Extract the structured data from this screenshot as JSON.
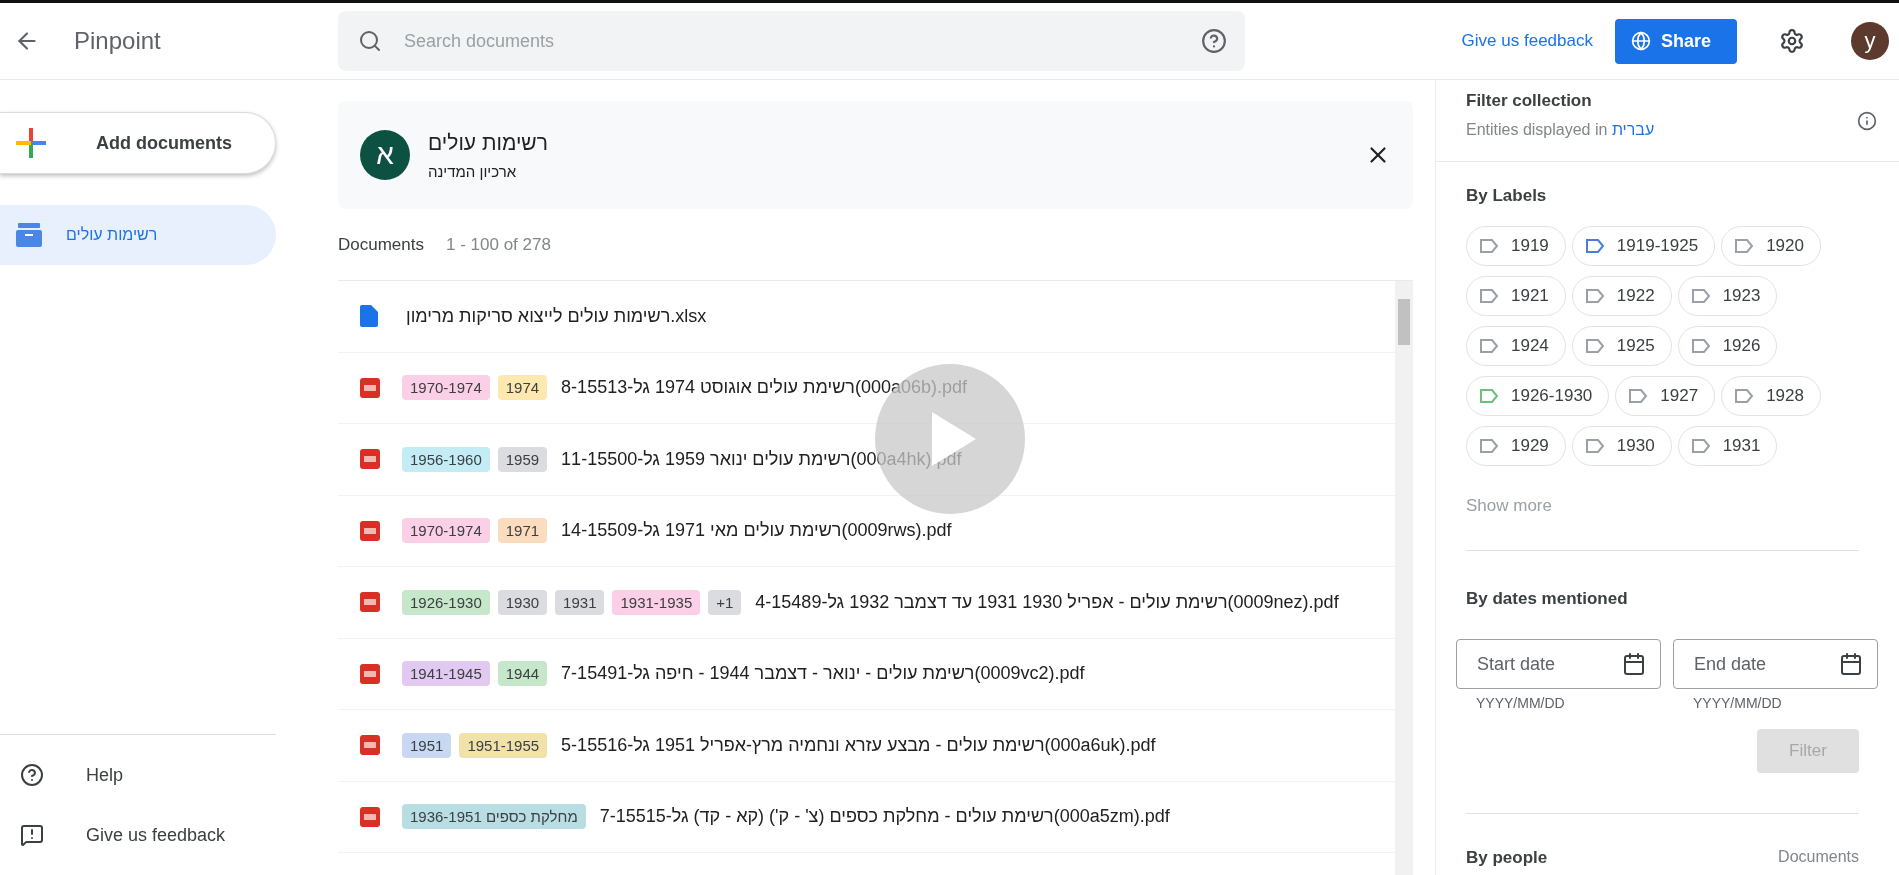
{
  "header": {
    "title": "Pinpoint",
    "search": {
      "placeholder": "Search documents"
    },
    "feedback_link": "Give us feedback",
    "share_button": "Share",
    "avatar": "y"
  },
  "sidebar": {
    "add_button": "Add documents",
    "collections": [
      {
        "label": "רשימות עולים",
        "selected": true
      }
    ],
    "footer": [
      {
        "kind": "help",
        "label": "Help"
      },
      {
        "kind": "feedback",
        "label": "Give us feedback"
      }
    ]
  },
  "collection": {
    "avatar": "א",
    "title": "רשימות עולים",
    "subtitle": "ארכיון המדינה"
  },
  "documents": {
    "title": "Documents",
    "range": "1 - 100 of 278",
    "rows": [
      {
        "kind": "sheet",
        "name": "רשימות עולים לייצוא סריקות מרימון.xlsx"
      },
      {
        "kind": "pdf",
        "name": "רשימת עולים אוגוסט 1974 גל-8-15513(000a06b).pdf",
        "tags": [
          {
            "label": "1970-1974",
            "color": "#fbd0e6"
          },
          {
            "label": "1974",
            "color": "#fde9b0"
          }
        ]
      },
      {
        "kind": "pdf",
        "name": "רשימת עולים ינואר 1959 גל-11-15500(000a4hk).pdf",
        "tags": [
          {
            "label": "1956-1960",
            "color": "#c4ecf5"
          },
          {
            "label": "1959",
            "color": "#dadce0"
          }
        ]
      },
      {
        "kind": "pdf",
        "name": "רשימת עולים מאי 1971 גל-14-15509(0009rws).pdf",
        "tags": [
          {
            "label": "1970-1974",
            "color": "#fbd0e6"
          },
          {
            "label": "1971",
            "color": "#fcdcbf"
          }
        ]
      },
      {
        "kind": "pdf",
        "name": "רשימת עולים - אפריל 1930 1931 עד דצמבר 1932 גל-4-15489(0009nez).pdf",
        "tags": [
          {
            "label": "1926-1930",
            "color": "#c6e7c9"
          },
          {
            "label": "1930",
            "color": "#dadce0"
          },
          {
            "label": "1931",
            "color": "#dadce0"
          },
          {
            "label": "1931-1935",
            "color": "#fbd0e6"
          },
          {
            "label": "+1",
            "color": "#dadce0"
          }
        ]
      },
      {
        "kind": "pdf",
        "name": "רשימת עולים - ינואר - דצמבר 1944 - חיפה גל-7-15491(0009vc2).pdf",
        "tags": [
          {
            "label": "1941-1945",
            "color": "#e2c9f2"
          },
          {
            "label": "1944",
            "color": "#c6e7c9"
          }
        ]
      },
      {
        "kind": "pdf",
        "name": "רשימת עולים - מבצע עזרא ונחמיה מרץ-אפריל 1951 גל-5-15516(000a6uk).pdf",
        "tags": [
          {
            "label": "1951",
            "color": "#c8d8f2"
          },
          {
            "label": "1951-1955",
            "color": "#f1e2a9"
          }
        ]
      },
      {
        "kind": "pdf",
        "name": "רשימת עולים - מחלקת כספים (צ' - ק') (קא - קד) גל-7-15515(000a5zm).pdf",
        "tags": [
          {
            "label": "1936-1951 מחלקת כספים",
            "color": "#b8dde2"
          }
        ]
      }
    ]
  },
  "filter": {
    "title": "Filter collection",
    "entities_prefix": "Entities displayed in",
    "entities_language": "עברית",
    "labels_title": "By Labels",
    "labels": [
      {
        "label": "1919",
        "color": "#9aa0a6"
      },
      {
        "label": "1919-1925",
        "color": "#4a7fd6"
      },
      {
        "label": "1920",
        "color": "#9aa0a6"
      },
      {
        "label": "1921",
        "color": "#9aa0a6"
      },
      {
        "label": "1922",
        "color": "#9aa0a6"
      },
      {
        "label": "1923",
        "color": "#9aa0a6"
      },
      {
        "label": "1924",
        "color": "#9aa0a6"
      },
      {
        "label": "1925",
        "color": "#9aa0a6"
      },
      {
        "label": "1926",
        "color": "#9aa0a6"
      },
      {
        "label": "1926-1930",
        "color": "#6cc07d"
      },
      {
        "label": "1927",
        "color": "#9aa0a6"
      },
      {
        "label": "1928",
        "color": "#9aa0a6"
      },
      {
        "label": "1929",
        "color": "#9aa0a6"
      },
      {
        "label": "1930",
        "color": "#9aa0a6"
      },
      {
        "label": "1931",
        "color": "#9aa0a6"
      }
    ],
    "show_more": "Show more",
    "dates_title": "By dates mentioned",
    "dates": [
      {
        "placeholder": "Start date",
        "hint": "YYYY/MM/DD"
      },
      {
        "placeholder": "End date",
        "hint": "YYYY/MM/DD"
      }
    ],
    "filter_button": {
      "label": "Filter",
      "disabled": true
    },
    "people_title": "By people",
    "people_column": "Documents"
  }
}
